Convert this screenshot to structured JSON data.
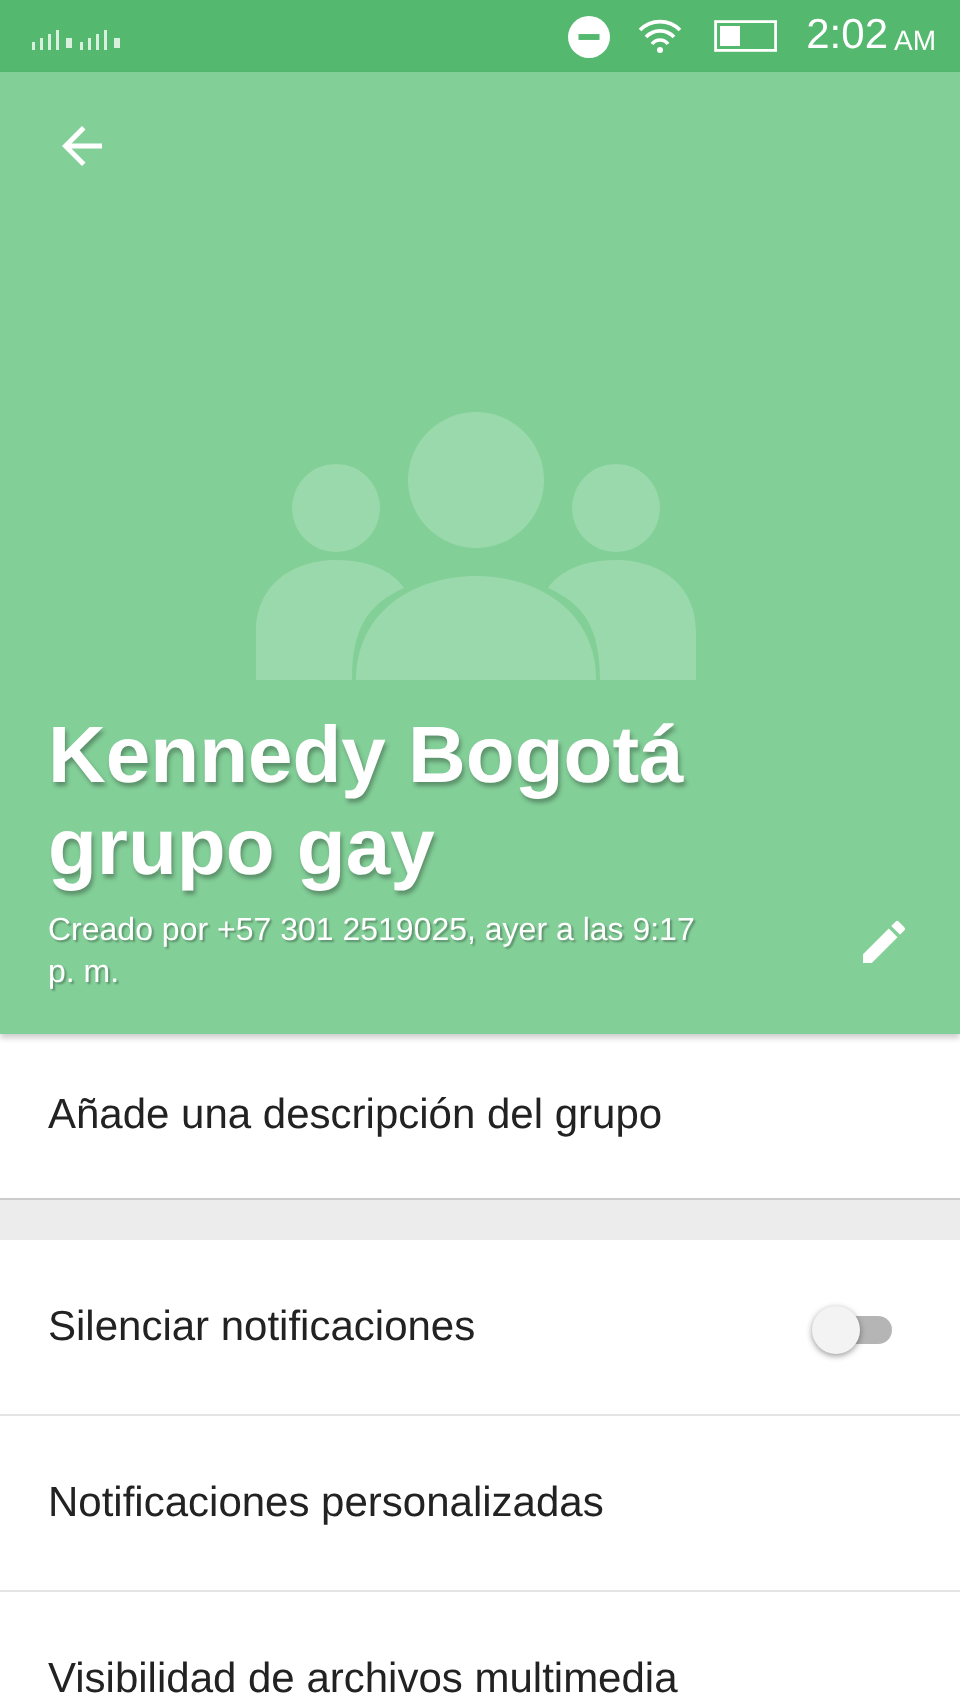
{
  "status_bar": {
    "time": "2:02",
    "ampm": "AM"
  },
  "header": {
    "title": "Kennedy Bogotá grupo gay",
    "subtitle": "Creado por +57 301 2519025, ayer a las 9:17 p. m."
  },
  "description": {
    "placeholder": "Añade una descripción del grupo"
  },
  "settings": [
    {
      "kind": "toggle",
      "label": "Silenciar notificaciones",
      "on": false
    },
    {
      "kind": "plain",
      "label": "Notificaciones personalizadas"
    },
    {
      "kind": "plain",
      "label": "Visibilidad de archivos multimedia"
    }
  ]
}
